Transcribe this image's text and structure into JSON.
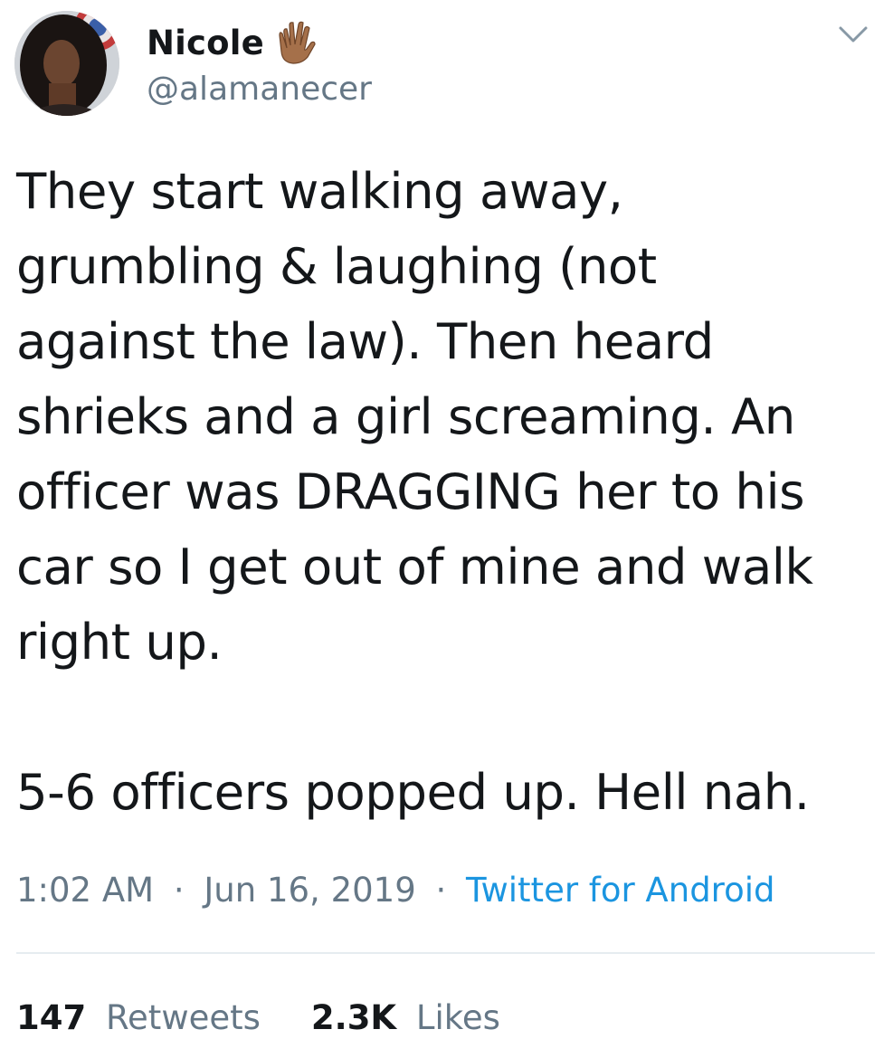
{
  "user": {
    "display_name": "Nicole",
    "handle": "@alamanecer",
    "name_emoji": "vulcan-salute-icon"
  },
  "tweet": {
    "text": "They start walking away,\ngrumbling & laughing (not\nagainst the law). Then heard\nshrieks and a girl screaming. An\nofficer was DRAGGING her to his\ncar so I get out of mine and walk\nright up.\n\n5-6 officers popped up. Hell nah.",
    "time": "1:02 AM",
    "date": "Jun 16, 2019",
    "separator": "·",
    "source": "Twitter for Android"
  },
  "stats": {
    "retweets_count": "147",
    "retweets_label": "Retweets",
    "likes_count": "2.3K",
    "likes_label": "Likes"
  },
  "colors": {
    "text": "#14171a",
    "secondary": "#657786",
    "link": "#1b95e0",
    "divider": "#e6ecf0",
    "emoji_skin": "#a5704a"
  }
}
